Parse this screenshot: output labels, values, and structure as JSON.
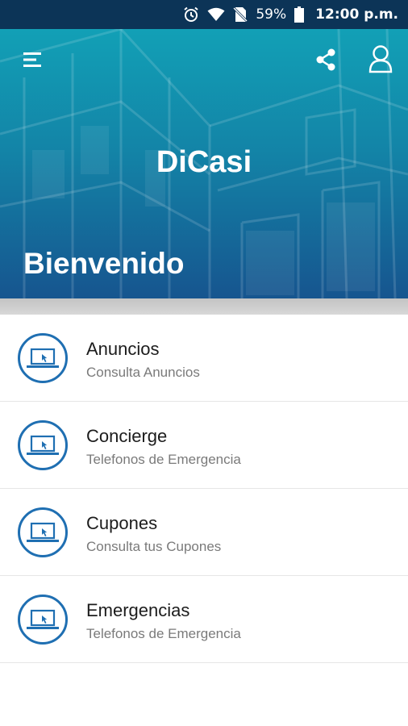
{
  "status_bar": {
    "icons": [
      "alarm-icon",
      "wifi-icon",
      "no-sim-icon",
      "battery-icon"
    ],
    "battery": "59%",
    "time": "12:00 p.m."
  },
  "header": {
    "menu_icon": "hamburger-menu-icon",
    "share_icon": "share-icon",
    "profile_icon": "user-profile-icon",
    "app_title": "DiCasi",
    "welcome": "Bienvenido"
  },
  "colors": {
    "status_bar": "#0c3457",
    "accent": "#1f6fb2",
    "title_text": "#1c1c1c",
    "subtitle_text": "#7a7a7a"
  },
  "menu": {
    "items": [
      {
        "title": "Anuncios",
        "subtitle": "Consulta Anuncios",
        "icon": "laptop-cursor-icon"
      },
      {
        "title": "Concierge",
        "subtitle": "Telefonos de Emergencia",
        "icon": "laptop-cursor-icon"
      },
      {
        "title": "Cupones",
        "subtitle": "Consulta tus Cupones",
        "icon": "laptop-cursor-icon"
      },
      {
        "title": "Emergencias",
        "subtitle": "Telefonos de Emergencia",
        "icon": "laptop-cursor-icon"
      }
    ]
  }
}
